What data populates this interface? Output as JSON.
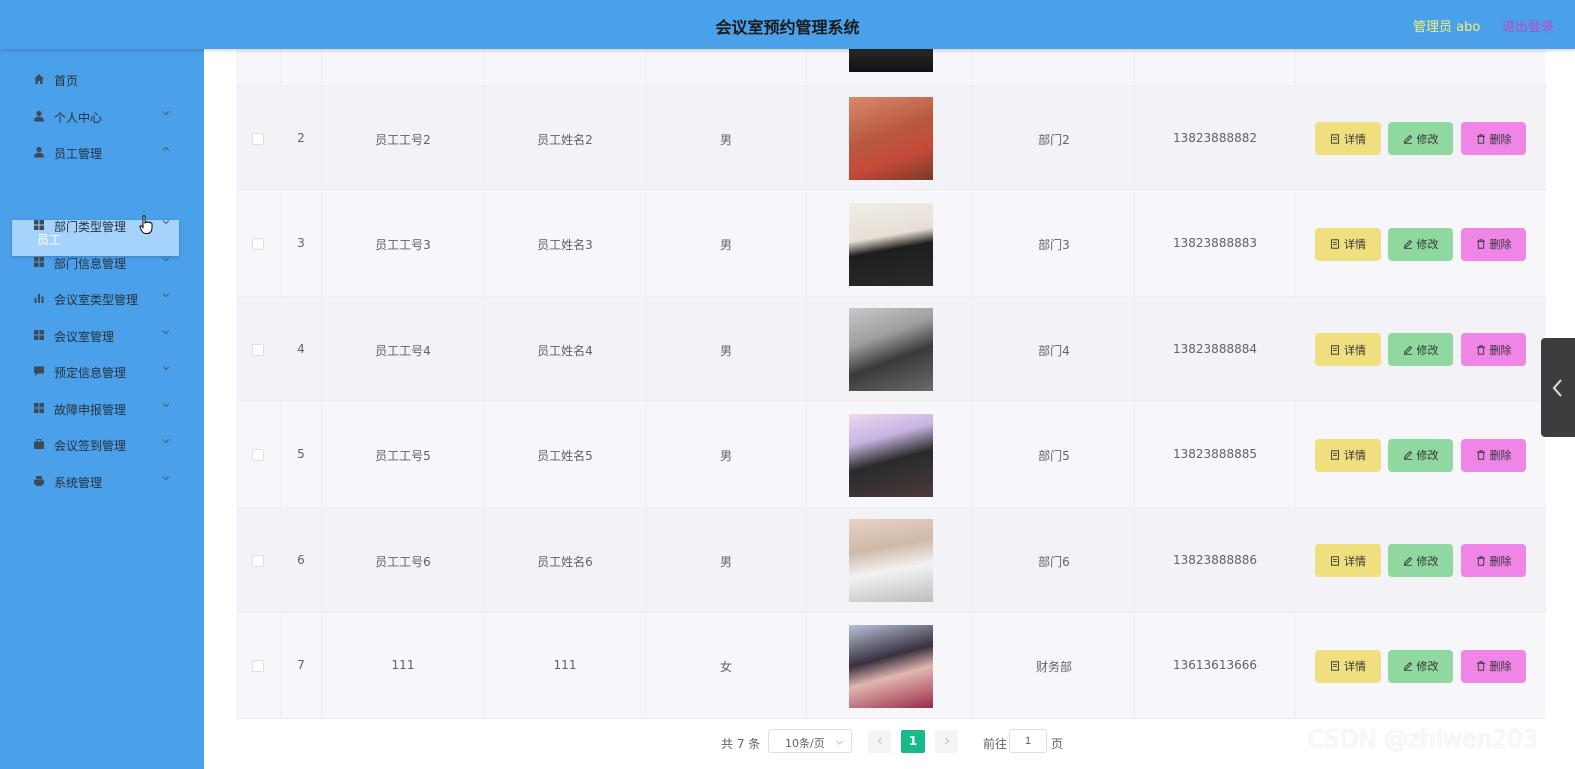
{
  "header": {
    "title": "会议室预约管理系统",
    "admin_label": "管理员 abo",
    "logout_label": "退出登录"
  },
  "sidebar": {
    "items": [
      {
        "label": "首页",
        "icon": "home-icon"
      },
      {
        "label": "个人中心",
        "icon": "user-icon"
      },
      {
        "label": "员工管理",
        "icon": "user-icon"
      },
      {
        "label": "部门类型管理",
        "icon": "grid-icon"
      },
      {
        "label": "部门信息管理",
        "icon": "grid-icon"
      },
      {
        "label": "会议室类型管理",
        "icon": "bar-chart-icon"
      },
      {
        "label": "会议室管理",
        "icon": "grid-icon"
      },
      {
        "label": "预定信息管理",
        "icon": "chat-icon"
      },
      {
        "label": "故障申报管理",
        "icon": "grid-icon"
      },
      {
        "label": "会议签到管理",
        "icon": "briefcase-icon"
      },
      {
        "label": "系统管理",
        "icon": "printer-icon"
      }
    ],
    "active_submenu": "员工"
  },
  "table": {
    "rows": [
      {
        "index": "2",
        "emp_no": "员工工号2",
        "emp_name": "员工姓名2",
        "gender": "男",
        "dept": "部门2",
        "phone": "13823888882"
      },
      {
        "index": "3",
        "emp_no": "员工工号3",
        "emp_name": "员工姓名3",
        "gender": "男",
        "dept": "部门3",
        "phone": "13823888883"
      },
      {
        "index": "4",
        "emp_no": "员工工号4",
        "emp_name": "员工姓名4",
        "gender": "男",
        "dept": "部门4",
        "phone": "13823888884"
      },
      {
        "index": "5",
        "emp_no": "员工工号5",
        "emp_name": "员工姓名5",
        "gender": "男",
        "dept": "部门5",
        "phone": "13823888885"
      },
      {
        "index": "6",
        "emp_no": "员工工号6",
        "emp_name": "员工姓名6",
        "gender": "男",
        "dept": "部门6",
        "phone": "13823888886"
      },
      {
        "index": "7",
        "emp_no": "111",
        "emp_name": "111",
        "gender": "女",
        "dept": "财务部",
        "phone": "13613613666"
      }
    ],
    "actions": {
      "detail": "详情",
      "edit": "修改",
      "delete": "删除"
    }
  },
  "pagination": {
    "total": "共 7 条",
    "page_size": "10条/页",
    "current_page": "1",
    "goto_label": "前往",
    "goto_value": "1",
    "page_suffix": "页"
  },
  "watermark": "CSDN @zhiwen203",
  "colors": {
    "header_bg": "#4aa0e9",
    "sidebar_bg": "#4aa0e9",
    "active_submenu_bg": "#a6d3fb",
    "detail_button": "#efdf7f",
    "edit_button": "#8fd8a0",
    "delete_button": "#ef86e7",
    "current_page": "#19b98c"
  }
}
